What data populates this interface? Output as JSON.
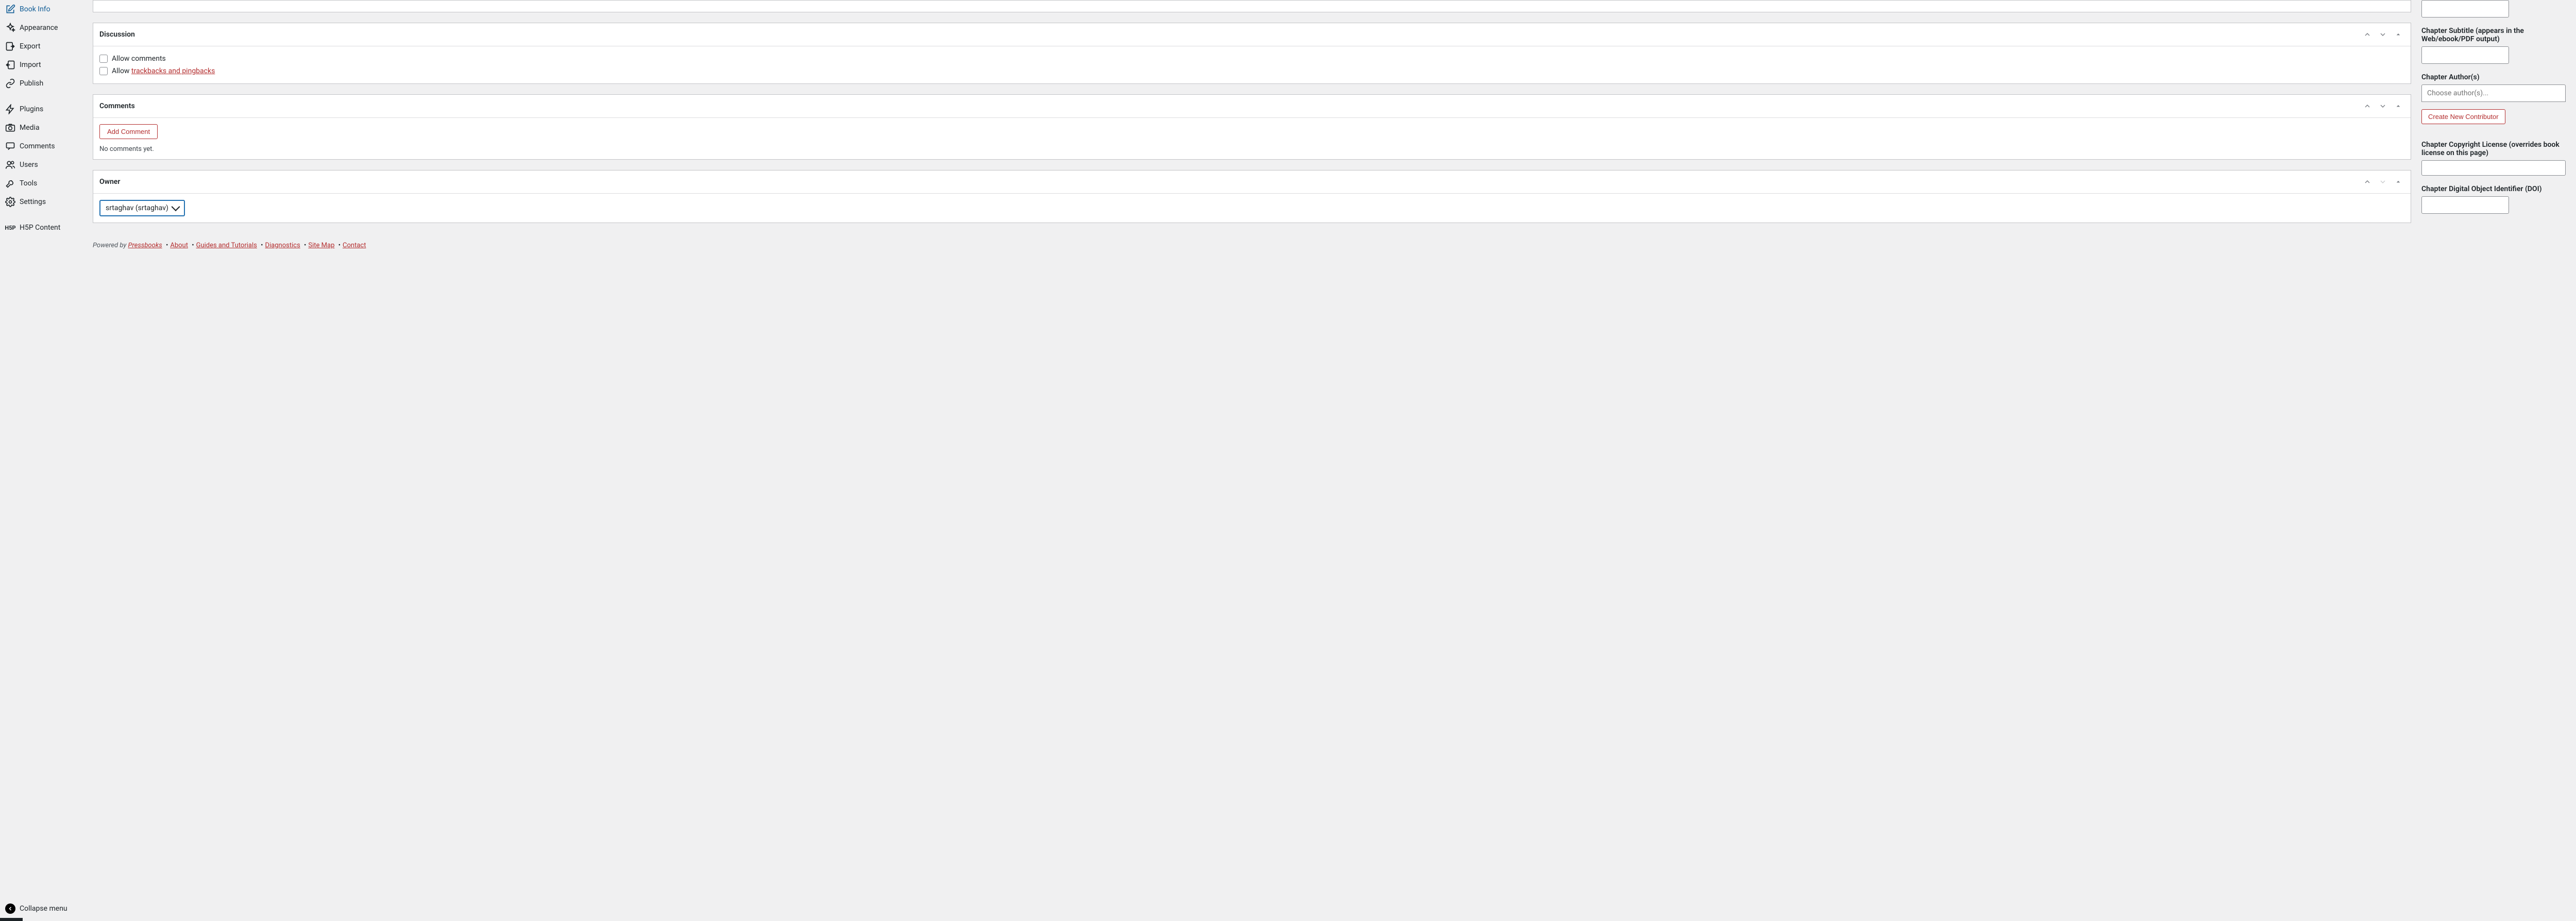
{
  "sidebar": {
    "items": [
      {
        "label": "Book Info"
      },
      {
        "label": "Appearance"
      },
      {
        "label": "Export"
      },
      {
        "label": "Import"
      },
      {
        "label": "Publish"
      },
      {
        "label": "Plugins"
      },
      {
        "label": "Media"
      },
      {
        "label": "Comments"
      },
      {
        "label": "Users"
      },
      {
        "label": "Tools"
      },
      {
        "label": "Settings"
      },
      {
        "label": "H5P Content"
      }
    ],
    "collapse_label": "Collapse menu"
  },
  "panels": {
    "discussion": {
      "title": "Discussion",
      "allow_comments_label": "Allow comments",
      "allow_trackbacks_prefix": "Allow ",
      "trackbacks_link": "trackbacks and pingbacks"
    },
    "comments": {
      "title": "Comments",
      "add_button": "Add Comment",
      "empty_text": "No comments yet."
    },
    "owner": {
      "title": "Owner",
      "selected": "srtaghav (srtaghav)"
    }
  },
  "right": {
    "chapter_subtitle_label": "Chapter Subtitle (appears in the Web/ebook/PDF output)",
    "chapter_authors_label": "Chapter Author(s)",
    "choose_authors_placeholder": "Choose author(s)...",
    "create_contributor_button": "Create New Contributor",
    "copyright_label": "Chapter Copyright License (overrides book license on this page)",
    "doi_label": "Chapter Digital Object Identifier (DOI)"
  },
  "footer": {
    "powered_by": "Powered by ",
    "pressbooks": "Pressbooks",
    "about": "About",
    "guides": "Guides and Tutorials",
    "diagnostics": "Diagnostics",
    "sitemap": "Site Map",
    "contact": "Contact"
  }
}
